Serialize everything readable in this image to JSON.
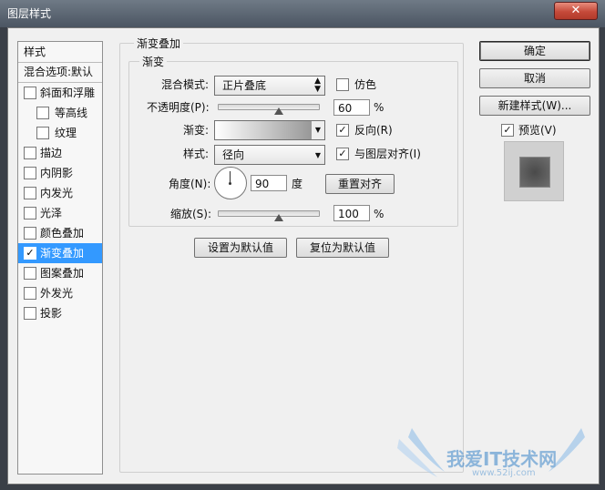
{
  "window": {
    "title": "图层样式",
    "close_glyph": "✕"
  },
  "left_panel": {
    "header": "样式",
    "blend_options": "混合选项:默认",
    "items": [
      {
        "label": "斜面和浮雕",
        "checked": false
      },
      {
        "label": "等高线",
        "checked": false
      },
      {
        "label": "纹理",
        "checked": false
      },
      {
        "label": "描边",
        "checked": false
      },
      {
        "label": "内阴影",
        "checked": false
      },
      {
        "label": "内发光",
        "checked": false
      },
      {
        "label": "光泽",
        "checked": false
      },
      {
        "label": "颜色叠加",
        "checked": false
      },
      {
        "label": "渐变叠加",
        "checked": true
      },
      {
        "label": "图案叠加",
        "checked": false
      },
      {
        "label": "外发光",
        "checked": false
      },
      {
        "label": "投影",
        "checked": false
      }
    ]
  },
  "main": {
    "group_title": "渐变叠加",
    "sub_title": "渐变",
    "blend_mode": {
      "label": "混合模式:",
      "value": "正片叠底"
    },
    "dither": {
      "label": "仿色",
      "checked": false
    },
    "opacity": {
      "label": "不透明度(P):",
      "value": "60",
      "unit": "%",
      "level": 0.6
    },
    "gradient": {
      "label": "渐变:"
    },
    "reverse": {
      "label": "反向(R)",
      "checked": true
    },
    "style": {
      "label": "样式:",
      "value": "径向"
    },
    "align": {
      "label": "与图层对齐(I)",
      "checked": true
    },
    "angle": {
      "label": "角度(N):",
      "value": "90",
      "unit": "度"
    },
    "reset_align_button": "重置对齐",
    "scale": {
      "label": "缩放(S):",
      "value": "100",
      "unit": "%",
      "level": 0.5
    },
    "make_default_button": "设置为默认值",
    "reset_default_button": "复位为默认值"
  },
  "right": {
    "ok_button": "确定",
    "cancel_button": "取消",
    "new_style_button": "新建样式(W)...",
    "preview": {
      "label": "预览(V)",
      "checked": true
    }
  },
  "watermark": {
    "text": "我爱IT技术网",
    "url": "www.52ij.com"
  },
  "colors": {
    "selection": "#3399ff",
    "panel": "#f0f0f0",
    "close_red": "#c54a3a"
  },
  "check_glyph": "✓"
}
